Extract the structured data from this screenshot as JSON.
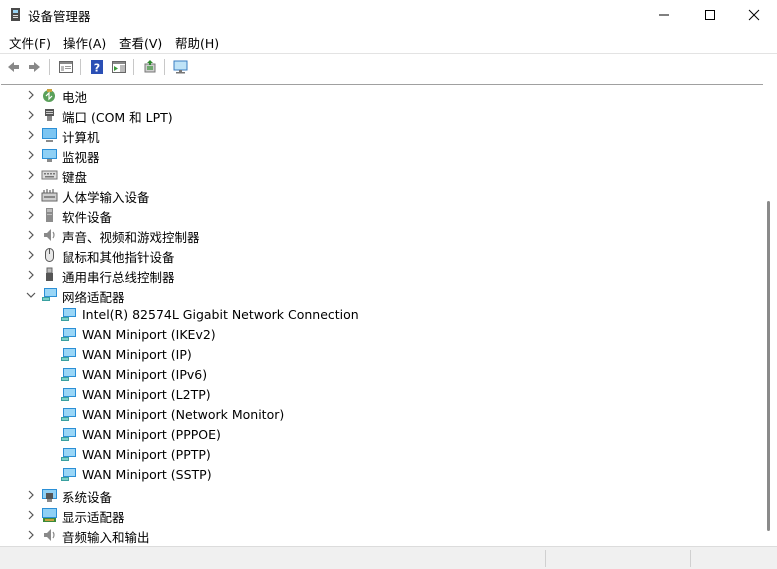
{
  "window": {
    "title": "设备管理器",
    "icon": "device-manager-icon",
    "controls": [
      "minimize-icon",
      "maximize-icon",
      "close-icon"
    ]
  },
  "menu": [
    "文件(F)",
    "操作(A)",
    "查看(V)",
    "帮助(H)"
  ],
  "toolbar": {
    "buttons": [
      "back-icon",
      "forward-icon",
      "properties-pane-icon",
      "help-icon",
      "action-pane-icon",
      "update-driver-icon",
      "scan-hardware-icon"
    ]
  },
  "tree": [
    {
      "label": "电池",
      "expanded": false,
      "icon": "battery-icon"
    },
    {
      "label": "端口 (COM 和 LPT)",
      "expanded": false,
      "icon": "port-icon"
    },
    {
      "label": "计算机",
      "expanded": false,
      "icon": "computer-icon"
    },
    {
      "label": "监视器",
      "expanded": false,
      "icon": "monitor-icon"
    },
    {
      "label": "键盘",
      "expanded": false,
      "icon": "keyboard-icon"
    },
    {
      "label": "人体学输入设备",
      "expanded": false,
      "icon": "hid-icon"
    },
    {
      "label": "软件设备",
      "expanded": false,
      "icon": "software-device-icon"
    },
    {
      "label": "声音、视频和游戏控制器",
      "expanded": false,
      "icon": "speaker-icon"
    },
    {
      "label": "鼠标和其他指针设备",
      "expanded": false,
      "icon": "mouse-icon"
    },
    {
      "label": "通用串行总线控制器",
      "expanded": false,
      "icon": "usb-icon"
    },
    {
      "label": "网络适配器",
      "expanded": true,
      "icon": "network-adapter-icon",
      "children": [
        "Intel(R) 82574L Gigabit Network Connection",
        "WAN Miniport (IKEv2)",
        "WAN Miniport (IP)",
        "WAN Miniport (IPv6)",
        "WAN Miniport (L2TP)",
        "WAN Miniport (Network Monitor)",
        "WAN Miniport (PPPOE)",
        "WAN Miniport (PPTP)",
        "WAN Miniport (SSTP)"
      ]
    },
    {
      "label": "系统设备",
      "expanded": false,
      "icon": "system-device-icon"
    },
    {
      "label": "显示适配器",
      "expanded": false,
      "icon": "display-adapter-icon"
    },
    {
      "label": "音频输入和输出",
      "expanded": false,
      "icon": "audio-io-icon"
    }
  ]
}
